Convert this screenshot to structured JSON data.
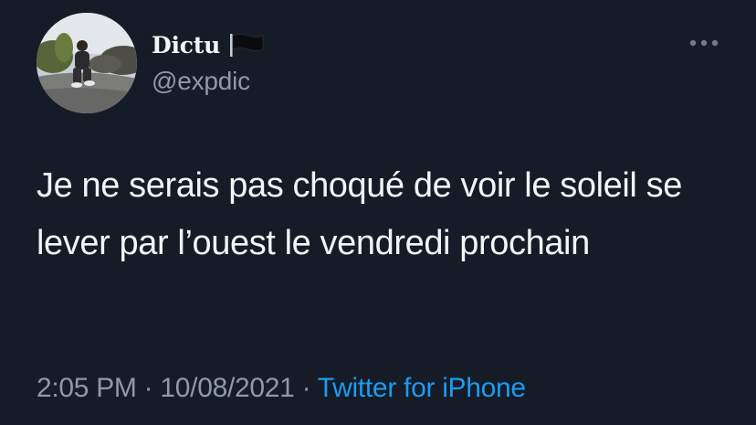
{
  "tweet": {
    "author": {
      "display_name": "Dictu",
      "handle": "@expdic",
      "flag_icon": "black-flag-icon",
      "avatar_icon": "profile-photo"
    },
    "more_icon": "more-horizontal-icon",
    "text": "Je ne serais pas choqué de voir le soleil se lever par l’ouest le vendredi prochain",
    "meta": {
      "time": "2:05 PM",
      "separator1": " · ",
      "date": "10/08/2021",
      "separator2": " · ",
      "source": "Twitter for iPhone"
    }
  },
  "colors": {
    "background": "#151c28",
    "primary_text": "#f2f4f6",
    "secondary_text": "#8d9aa7",
    "link": "#1d9bf0"
  }
}
